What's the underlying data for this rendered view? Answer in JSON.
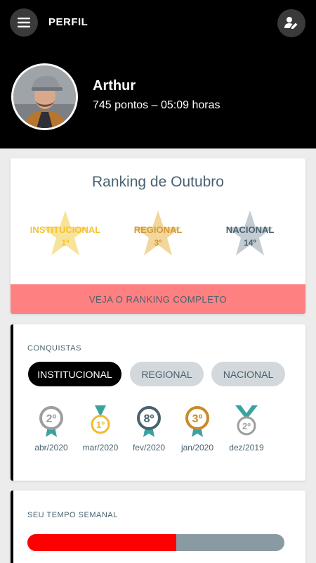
{
  "header": {
    "title": "PERFIL",
    "menu_icon": "hamburger-menu-icon",
    "edit_icon": "edit-profile-icon",
    "user": {
      "name": "Arthur",
      "stats": "745 pontos – 05:09 horas"
    }
  },
  "ranking": {
    "title": "Ranking de Outubro",
    "items": [
      {
        "label": "INSTITUCIONAL",
        "position": "1º",
        "color": "#f4c430",
        "star_color": "#f8e39a"
      },
      {
        "label": "REGIONAL",
        "position": "3º",
        "color": "#d39a34",
        "star_color": "#f1d79c"
      },
      {
        "label": "NACIONAL",
        "position": "14º",
        "color": "#48626f",
        "star_color": "#c3ccd2"
      }
    ],
    "button_label": "VEJA O RANKING COMPLETO"
  },
  "achievements": {
    "section_label": "CONQUISTAS",
    "tabs": [
      "INSTITUCIONAL",
      "REGIONAL",
      "NACIONAL"
    ],
    "active_tab": "INSTITUCIONAL",
    "medals": [
      {
        "rank": "2º",
        "month": "abr/2020",
        "color": "#9e9e9e",
        "ribbon": "#3aa3a0"
      },
      {
        "rank": "1º",
        "month": "mar/2020",
        "color": "#f4b830",
        "ribbon": "#3aa3a0"
      },
      {
        "rank": "8º",
        "month": "fev/2020",
        "color": "#48626f",
        "ribbon": "#3aa3a0"
      },
      {
        "rank": "3º",
        "month": "jan/2020",
        "color": "#c98a2a",
        "ribbon": "#3aa3a0"
      },
      {
        "rank": "2º",
        "month": "dez/2019",
        "color": "#9e9e9e",
        "ribbon": "#3aa3a0"
      }
    ]
  },
  "weekly_time": {
    "section_label": "SEU TEMPO SEMANAL",
    "progress_fraction": 0.58,
    "fill_color": "#ff0000",
    "track_color": "#8a9aa3"
  },
  "colors": {
    "header_bg": "#000000",
    "accent_text": "#48626f",
    "cta_bg": "#ff8080"
  }
}
